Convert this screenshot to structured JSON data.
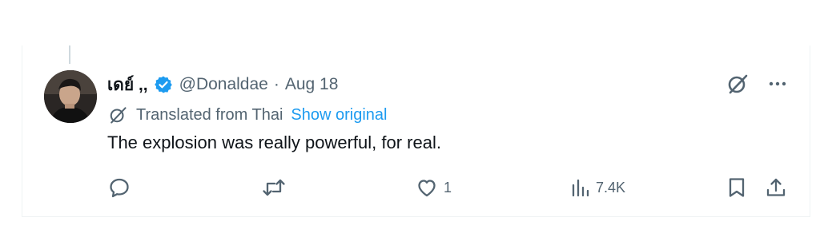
{
  "tweet": {
    "display_name": "เดย์ ,,",
    "handle": "@Donaldae",
    "separator": "·",
    "date": "Aug 18",
    "translated_label": "Translated from Thai",
    "show_original_label": "Show original",
    "text": "The explosion was really powerful, for real."
  },
  "actions": {
    "reply_count": "",
    "retweet_count": "",
    "like_count": "1",
    "views_count": "7.4K"
  },
  "icons": {
    "verified": "verified-badge-icon",
    "grok": "grok-icon",
    "more": "more-icon",
    "translate": "translate-icon",
    "reply": "reply-icon",
    "retweet": "retweet-icon",
    "like": "heart-icon",
    "views": "views-icon",
    "bookmark": "bookmark-icon",
    "share": "share-icon"
  },
  "colors": {
    "text": "#0f1419",
    "secondary": "#536471",
    "accent": "#1d9bf0",
    "border": "#eff3f4"
  }
}
